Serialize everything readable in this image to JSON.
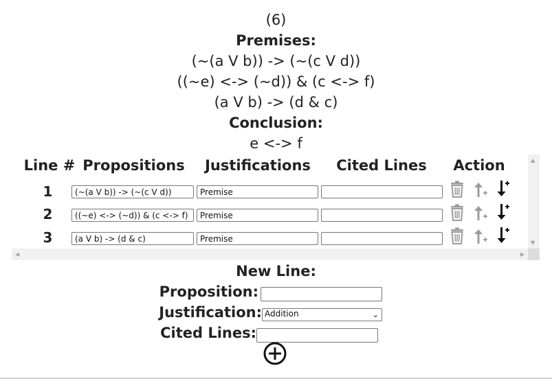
{
  "problem": {
    "number": "(6)",
    "premises_label": "Premises:",
    "premises": [
      "(~(a V b)) -> (~(c V d))",
      "((~e) <-> (~d)) & (c <-> f)",
      "(a V b) -> (d & c)"
    ],
    "conclusion_label": "Conclusion:",
    "conclusion": "e <-> f"
  },
  "table": {
    "headers": {
      "line": "Line #",
      "propositions": "Propositions",
      "justifications": "Justifications",
      "cited": "Cited Lines",
      "action": "Action"
    },
    "rows": [
      {
        "num": "1",
        "proposition": "(~(a V b)) -> (~(c V d))",
        "justification": "Premise",
        "cited": ""
      },
      {
        "num": "2",
        "proposition": "((~e) <-> (~d)) & (c <-> f)",
        "justification": "Premise",
        "cited": ""
      },
      {
        "num": "3",
        "proposition": "(a V b) -> (d & c)",
        "justification": "Premise",
        "cited": ""
      }
    ],
    "action_icons": [
      "trash-icon",
      "move-up-icon",
      "insert-below-icon"
    ]
  },
  "new_line": {
    "title": "New Line:",
    "proposition_label": "Proposition:",
    "justification_label": "Justification:",
    "justification_selected": "Addition",
    "cited_label": "Cited Lines:",
    "add_icon": "plus-circle-icon"
  }
}
